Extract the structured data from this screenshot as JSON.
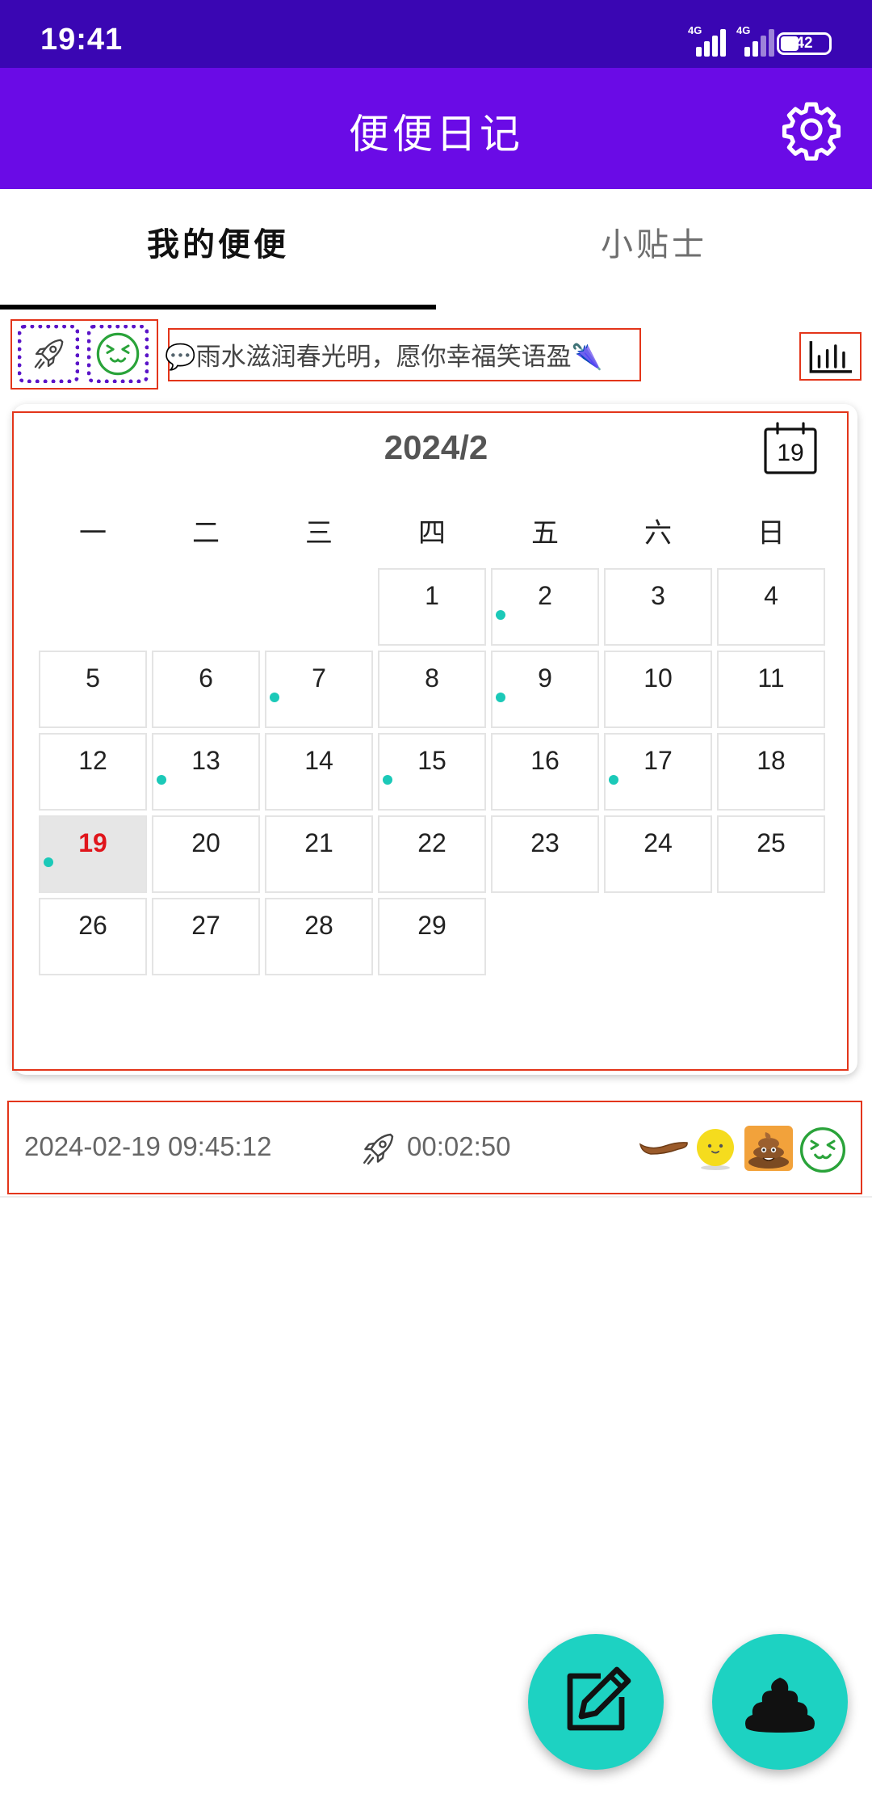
{
  "status_bar": {
    "time": "19:41",
    "signal_label_1": "4G",
    "signal_label_2": "4G",
    "battery": "42"
  },
  "app_bar": {
    "title": "便便日记"
  },
  "tabs": [
    {
      "label": "我的便便",
      "active": true
    },
    {
      "label": "小贴士",
      "active": false
    }
  ],
  "tip": {
    "text": "💬雨水滋润春光明，愿你幸福笑语盈🌂"
  },
  "calendar": {
    "month_label": "2024/2",
    "today_icon_day": "19",
    "weekdays": [
      "一",
      "二",
      "三",
      "四",
      "五",
      "六",
      "日"
    ],
    "first_weekday_index": 3,
    "days": [
      "1",
      "2",
      "3",
      "4",
      "5",
      "6",
      "7",
      "8",
      "9",
      "10",
      "11",
      "12",
      "13",
      "14",
      "15",
      "16",
      "17",
      "18",
      "19",
      "20",
      "21",
      "22",
      "23",
      "24",
      "25",
      "26",
      "27",
      "28",
      "29"
    ],
    "marked_days": [
      2,
      7,
      9,
      13,
      15,
      17,
      19
    ],
    "selected_day": 19
  },
  "record": {
    "datetime": "2024-02-19 09:45:12",
    "duration": "00:02:50"
  },
  "colors": {
    "status_bar": "#3a06b3",
    "app_bar": "#6a0be6",
    "accent": "#1dd2c2",
    "selected_day": "#e0151b",
    "highlight_box": "#e3351a"
  }
}
